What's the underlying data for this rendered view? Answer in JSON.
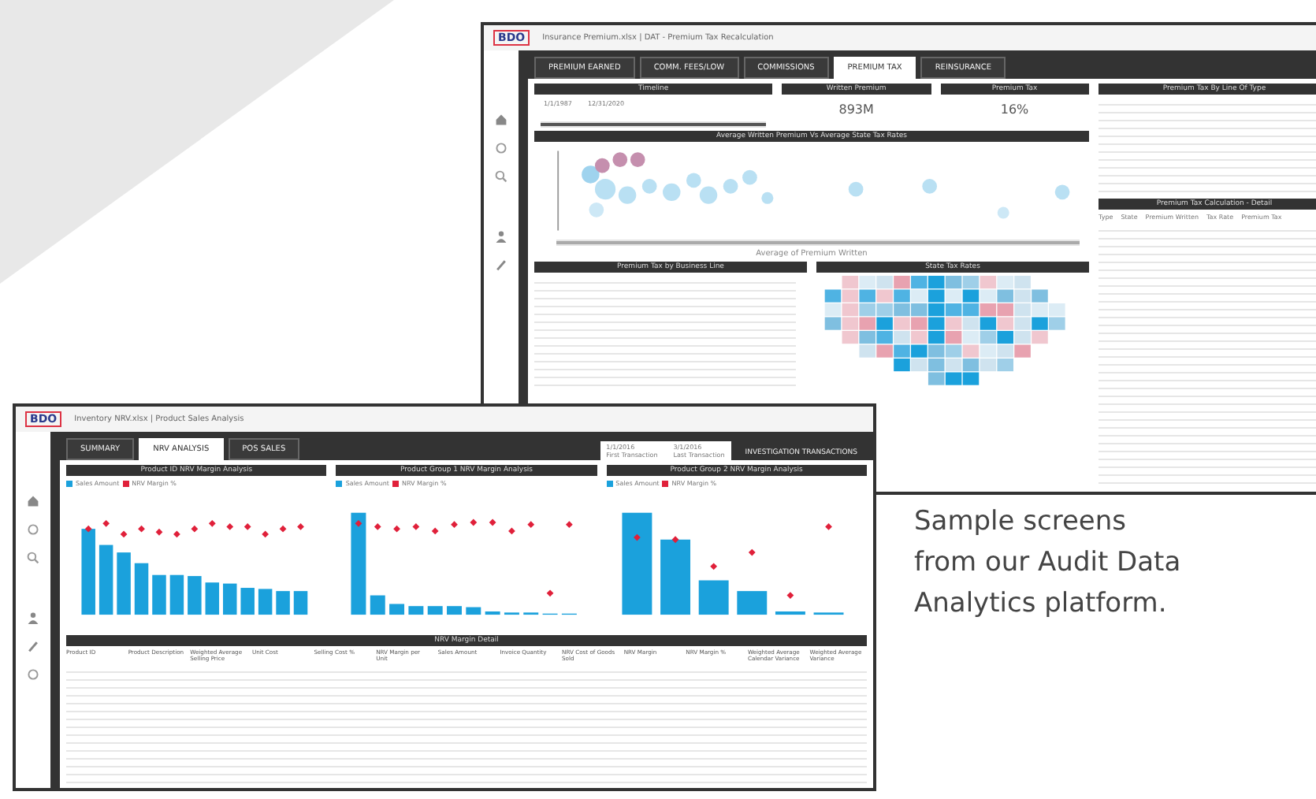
{
  "caption": "Sample screens\nfrom our Audit Data\nAnalytics platform.",
  "back_window": {
    "logo": "BDO",
    "title": "Insurance Premium.xlsx | DAT - Premium Tax Recalculation",
    "tabs": [
      {
        "label": "PREMIUM EARNED",
        "selected": false
      },
      {
        "label": "COMM. FEES/LOW",
        "selected": false
      },
      {
        "label": "COMMISSIONS",
        "selected": false
      },
      {
        "label": "PREMIUM TAX",
        "selected": true
      },
      {
        "label": "REINSURANCE",
        "selected": false
      }
    ],
    "timeline": {
      "header": "Timeline",
      "start": "1/1/1987",
      "end": "12/31/2020",
      "level": 1
    },
    "kpis": [
      {
        "header": "Written Premium",
        "value": "893M"
      },
      {
        "header": "Premium Tax",
        "value": "16%"
      }
    ],
    "bubble_header": "Average Written Premium Vs Average State Tax Rates",
    "bubble_range": {
      "level": 1
    },
    "bubble_xlabel": "Average of Premium Written",
    "bottom_headers": [
      "Premium Tax by Business Line",
      "State Tax Rates"
    ],
    "side_headers": [
      "Premium Tax By Line Of Type",
      "Premium Tax Calculation - Detail"
    ],
    "detail_columns": [
      "Type",
      "State",
      "Premium Written",
      "Tax Rate",
      "Premium Tax"
    ]
  },
  "front_window": {
    "logo": "BDO",
    "title": "Inventory NRV.xlsx | Product Sales Analysis",
    "tabs": [
      {
        "label": "SUMMARY",
        "selected": false
      },
      {
        "label": "NRV ANALYSIS",
        "selected": true
      },
      {
        "label": "POS SALES",
        "selected": false
      }
    ],
    "dates": [
      {
        "date": "1/1/2016",
        "label": "First Transaction"
      },
      {
        "date": "3/1/2016",
        "label": "Last Transaction"
      }
    ],
    "action": "INVESTIGATION TRANSACTIONS",
    "charts": [
      {
        "header": "Product ID NRV Margin Analysis",
        "kind": "falling",
        "legend": [
          {
            "label": "Sales Amount",
            "color": "#1ba1dc"
          },
          {
            "label": "NRV Margin %",
            "color": "#e0203a"
          }
        ]
      },
      {
        "header": "Product Group 1 NRV Margin Analysis",
        "kind": "steep",
        "legend": [
          {
            "label": "Sales Amount",
            "color": "#1ba1dc"
          },
          {
            "label": "NRV Margin %",
            "color": "#e0203a"
          }
        ]
      },
      {
        "header": "Product Group 2 NRV Margin Analysis",
        "kind": "few",
        "legend": [
          {
            "label": "Sales Amount",
            "color": "#1ba1dc"
          },
          {
            "label": "NRV Margin %",
            "color": "#e0203a"
          }
        ]
      }
    ],
    "table_header": "NRV Margin Detail",
    "columns": [
      "Product ID",
      "Product Description",
      "Weighted Average Selling Price",
      "Unit Cost",
      "Selling Cost %",
      "NRV Margin per Unit",
      "Sales Amount",
      "Invoice Quantity",
      "NRV Cost of Goods Sold",
      "NRV Margin",
      "NRV Margin %",
      "Weighted Average Calendar Variance",
      "Weighted Average Variance"
    ]
  }
}
